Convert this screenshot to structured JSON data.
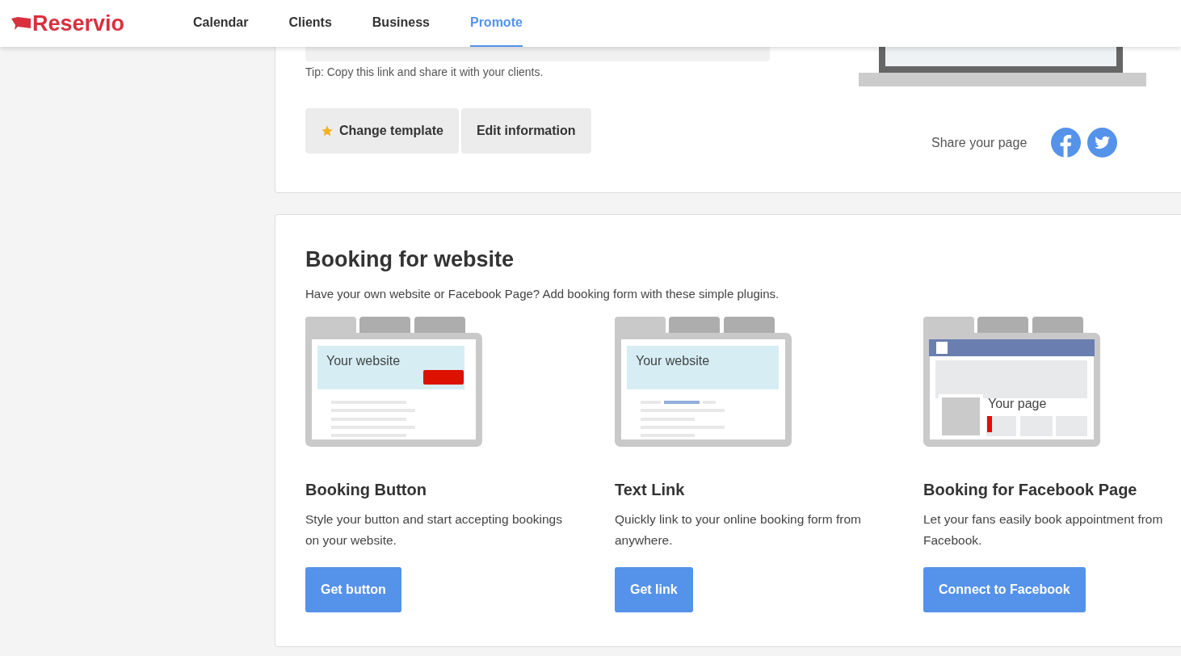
{
  "header": {
    "logo": "Reservio",
    "tabs": [
      {
        "label": "Calendar",
        "selected": false
      },
      {
        "label": "Clients",
        "selected": false
      },
      {
        "label": "Business",
        "selected": false
      },
      {
        "label": "Promote",
        "selected": true
      }
    ]
  },
  "share_card": {
    "tip": "Tip: Copy this link and share it with your clients.",
    "buttons": [
      {
        "label": "Change template",
        "kind": "star"
      },
      {
        "label": "Edit information",
        "kind": "plain"
      }
    ],
    "share_label": "Share your page"
  },
  "booking": {
    "title": "Booking for website",
    "subtitle": "Have your own website or Facebook Page? Add booking form with these simple plugins.",
    "plugins": [
      {
        "kind": "button",
        "preview_text": "Your website",
        "title": "Booking Button",
        "description": "Style your button and start accepting bookings on your website.",
        "action": "Get button"
      },
      {
        "kind": "link",
        "preview_text": "Your website",
        "title": "Text Link",
        "description": "Quickly link to your online booking form from anywhere.",
        "action": "Get link"
      },
      {
        "kind": "facebook",
        "preview_text": "Your page",
        "title": "Booking for Facebook Page",
        "description": "Let your fans easily book appointment from Facebook.",
        "action": "Connect to Facebook"
      }
    ]
  }
}
